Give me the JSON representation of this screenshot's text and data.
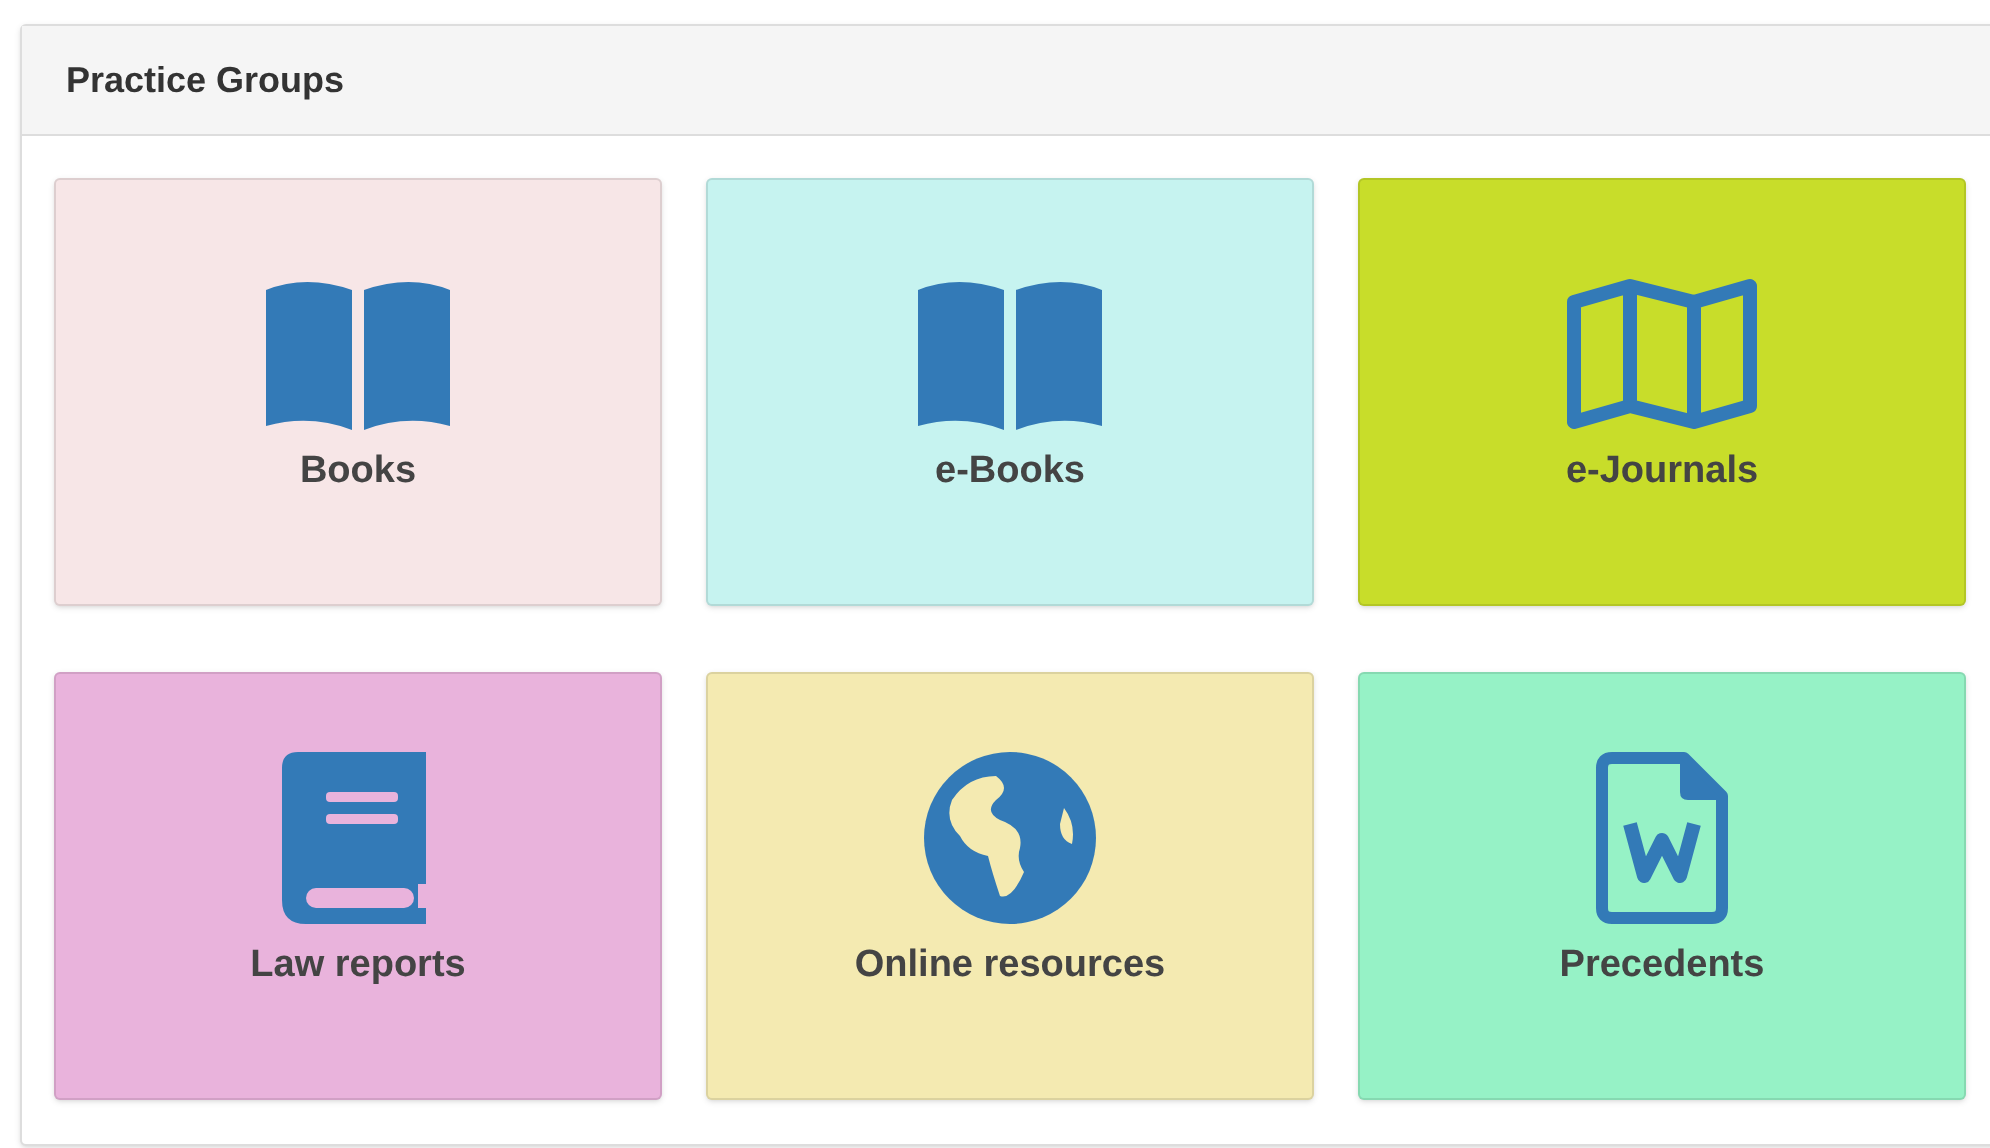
{
  "panel": {
    "title": "Practice Groups"
  },
  "tiles": [
    {
      "label": "Books",
      "kind": "open-book",
      "color": "#f7e6e7"
    },
    {
      "label": "e-Books",
      "kind": "open-book",
      "color": "#c6f3f0"
    },
    {
      "label": "e-Journals",
      "kind": "map",
      "color": "#c8dd2a"
    },
    {
      "label": "Law reports",
      "kind": "book",
      "color": "#e9b3dc"
    },
    {
      "label": "Online resources",
      "kind": "globe",
      "color": "#f4eab1"
    },
    {
      "label": "Precedents",
      "kind": "word-document",
      "color": "#96f2c6"
    }
  ]
}
